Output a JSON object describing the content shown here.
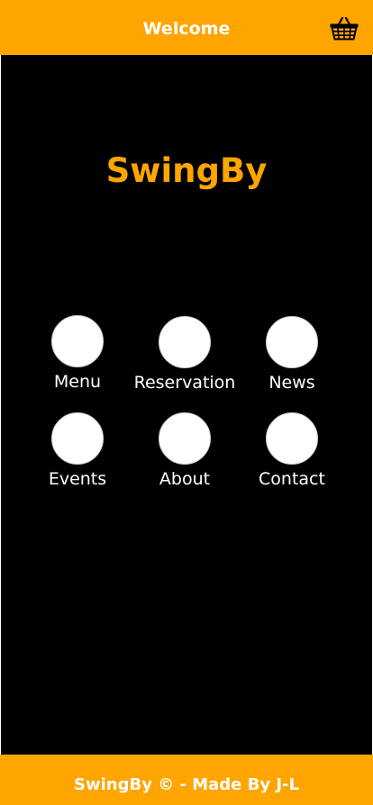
{
  "header": {
    "title": "Welcome",
    "cart_icon": "basket-icon"
  },
  "brand": {
    "name": "SwingBy"
  },
  "nav": {
    "items": [
      {
        "label": "Menu",
        "icon": "circle-icon"
      },
      {
        "label": "Reservation",
        "icon": "circle-icon"
      },
      {
        "label": "News",
        "icon": "circle-icon"
      },
      {
        "label": "Events",
        "icon": "circle-icon"
      },
      {
        "label": "About",
        "icon": "circle-icon"
      },
      {
        "label": "Contact",
        "icon": "circle-icon"
      }
    ]
  },
  "footer": {
    "text": "SwingBy © - Made By J-L"
  },
  "colors": {
    "accent": "#ffa500",
    "background": "#000000",
    "text": "#ffffff"
  }
}
